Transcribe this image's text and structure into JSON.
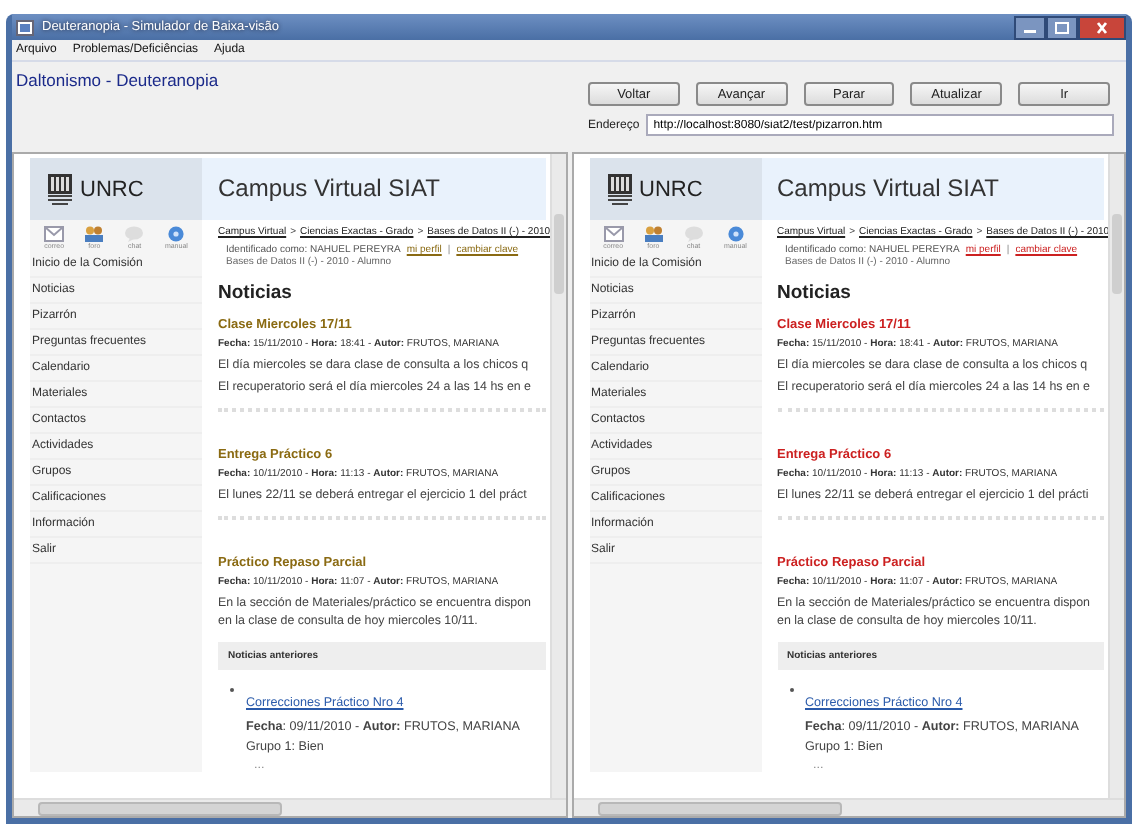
{
  "window": {
    "title": "Deuteranopia - Simulador de Baixa-visão"
  },
  "menu": [
    "Arquivo",
    "Problemas/Deficiências",
    "Ajuda"
  ],
  "simulation_label": "Daltonismo - Deuteranopia",
  "nav_buttons": [
    "Voltar",
    "Avançar",
    "Parar",
    "Atualizar",
    "Ir"
  ],
  "address": {
    "label": "Endereço",
    "value": "http://localhost:8080/siat2/test/pizarron.htm"
  },
  "panes": [
    {
      "color": "#8a6a12",
      "logo_text": "UNRC",
      "title": "Campus Virtual SIAT",
      "icons": [
        "correo",
        "foro",
        "chat",
        "manual"
      ],
      "sidebar": [
        "Inicio de la Comisión",
        "Noticias",
        "Pizarrón",
        "Preguntas frecuentes",
        "Calendario",
        "Materiales",
        "Contactos",
        "Actividades",
        "Grupos",
        "Calificaciones",
        "Información",
        "Salir"
      ],
      "breadcrumb": [
        "Campus Virtual",
        "Ciencias Exactas - Grado",
        "Bases de Datos II (-) - 2010"
      ],
      "breadcrumb_separator": ">",
      "user": "Identificado como: NAHUEL PEREYRA",
      "user_links": [
        "mi perfil",
        "cambiar clave"
      ],
      "link_separator": "|",
      "course": "Bases de Datos II (-) - 2010 - Alumno",
      "heading": "Noticias",
      "news": [
        {
          "title": "Clase Miercoles 17/11",
          "meta": "**Fecha:** 15/11/2010 - **Hora:** 18:41 - **Autor:** FRUTOS, MARIANA",
          "body": [
            "El día miercoles se dara clase de consulta a los chicos q",
            "El recuperatorio será el día miercoles 24 a las 14 hs en e"
          ]
        },
        {
          "title": "Entrega Práctico 6",
          "meta": "**Fecha:** 10/11/2010 - **Hora:** 11:13 - **Autor:** FRUTOS, MARIANA",
          "body": [
            "El lunes 22/11 se deberá entregar el ejercicio 1 del práct"
          ]
        },
        {
          "title": "Práctico Repaso Parcial",
          "meta": "**Fecha:** 10/11/2010 - **Hora:** 11:07 - **Autor:** FRUTOS, MARIANA",
          "body": [
            "En la sección de Materiales/práctico se encuentra dispon\nen la clase de consulta de hoy miercoles 10/11."
          ]
        }
      ],
      "previous": {
        "heading": "Noticias anteriores",
        "items": [
          {
            "link": "Correcciones Práctico Nro 4",
            "meta": "**Fecha**: 09/11/2010 - **Autor:** FRUTOS, MARIANA",
            "text": "Grupo 1: Bien"
          }
        ],
        "more": "..."
      }
    },
    {
      "color": "#cc2020",
      "logo_text": "UNRC",
      "title": "Campus Virtual SIAT",
      "icons": [
        "correo",
        "foro",
        "chat",
        "manual"
      ],
      "sidebar": [
        "Inicio de la Comisión",
        "Noticias",
        "Pizarrón",
        "Preguntas frecuentes",
        "Calendario",
        "Materiales",
        "Contactos",
        "Actividades",
        "Grupos",
        "Calificaciones",
        "Información",
        "Salir"
      ],
      "breadcrumb": [
        "Campus Virtual",
        "Ciencias Exactas - Grado",
        "Bases de Datos II (-) - 2010"
      ],
      "breadcrumb_separator": ">",
      "user": "Identificado como: NAHUEL PEREYRA",
      "user_links": [
        "mi perfil",
        "cambiar clave"
      ],
      "link_separator": "|",
      "course": "Bases de Datos II (-) - 2010 - Alumno",
      "heading": "Noticias",
      "news": [
        {
          "title": "Clase Miercoles 17/11",
          "meta": "**Fecha:** 15/11/2010 - **Hora:** 18:41 - **Autor:** FRUTOS, MARIANA",
          "body": [
            "El día miercoles se dara clase de consulta a los chicos q",
            "El recuperatorio será el día miercoles 24 a las 14 hs en e"
          ]
        },
        {
          "title": "Entrega Práctico 6",
          "meta": "**Fecha:** 10/11/2010 - **Hora:** 11:13 - **Autor:** FRUTOS, MARIANA",
          "body": [
            "El lunes 22/11 se deberá entregar el ejercicio 1 del prácti"
          ]
        },
        {
          "title": "Práctico Repaso Parcial",
          "meta": "**Fecha:** 10/11/2010 - **Hora:** 11:07 - **Autor:** FRUTOS, MARIANA",
          "body": [
            "En la sección de Materiales/práctico se encuentra dispon\nen la clase de consulta de hoy miercoles 10/11."
          ]
        }
      ],
      "previous": {
        "heading": "Noticias anteriores",
        "items": [
          {
            "link": "Correcciones Práctico Nro 4",
            "meta": "**Fecha**: 09/11/2010 - **Autor:** FRUTOS, MARIANA",
            "text": "Grupo 1: Bien"
          }
        ],
        "more": "..."
      }
    }
  ]
}
